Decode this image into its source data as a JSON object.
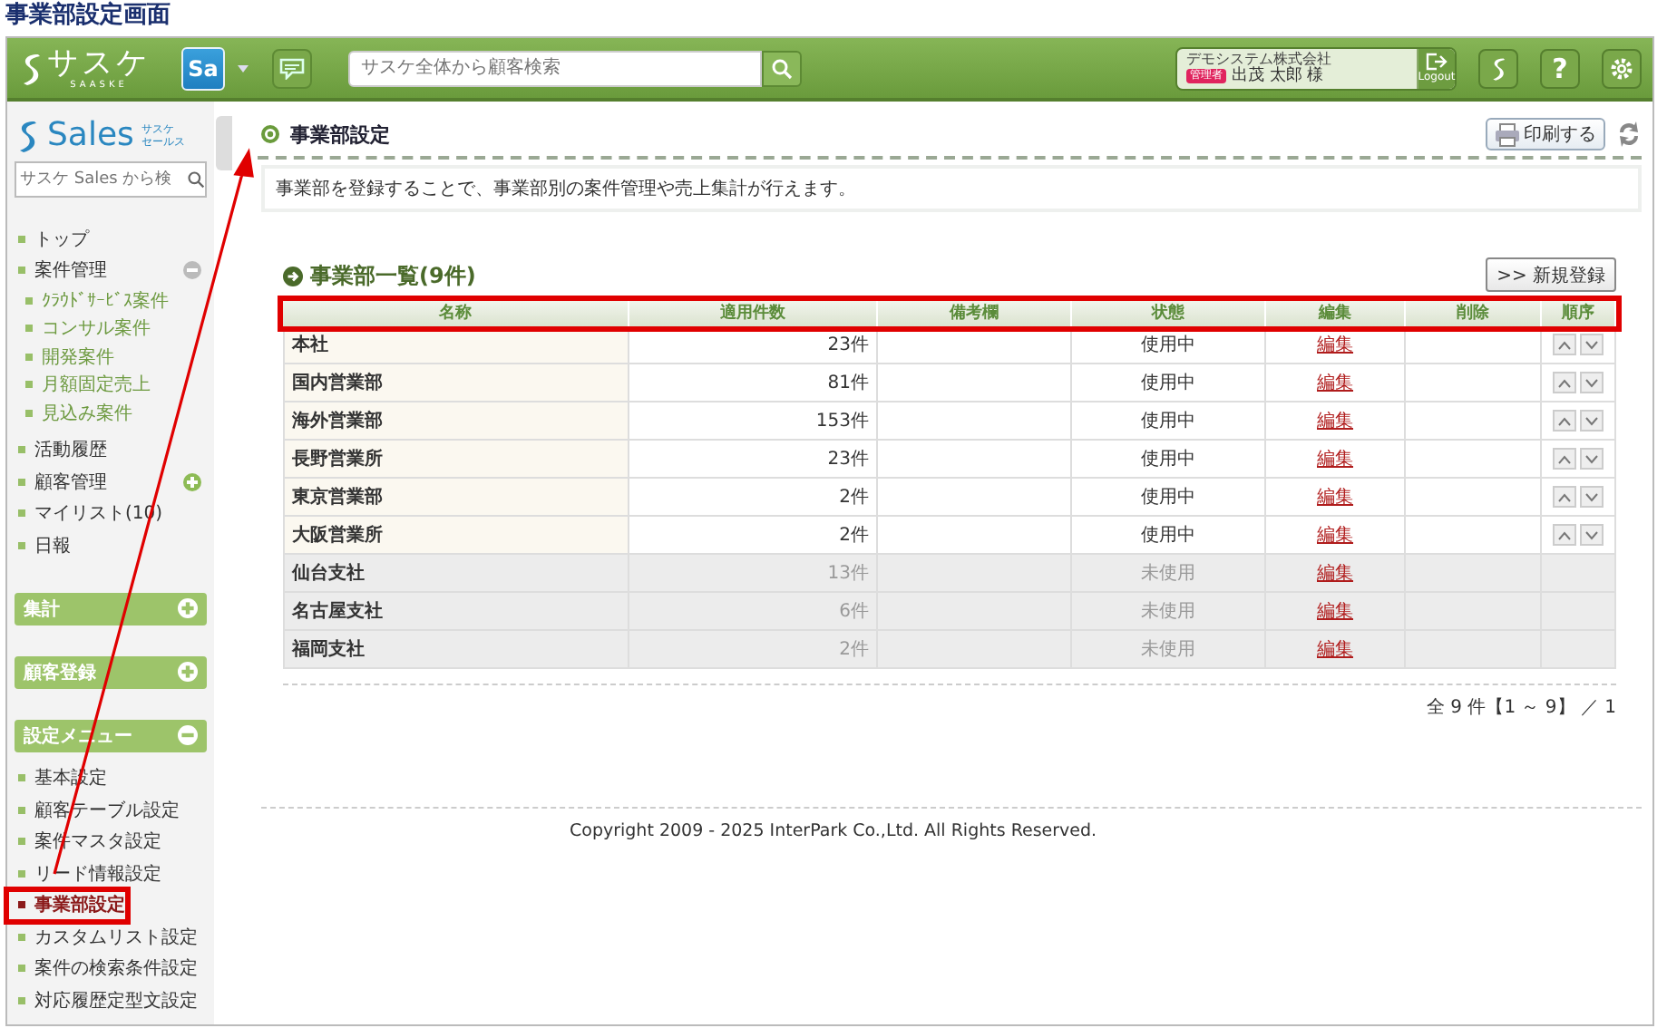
{
  "doc_title": "事業部設定画面",
  "header": {
    "logo": "サスケ",
    "logo_sub": "SAASKE",
    "app_badge": "Sa",
    "search": {
      "placeholder": "サスケ全体から顧客検索"
    },
    "company": "デモシステム株式会社",
    "role_badge": "管理者",
    "user": "出茂 太郎 様",
    "logout": "Logout",
    "help": "?"
  },
  "sidebar": {
    "brand": "Sales",
    "brand_sub": [
      "サスケ",
      "セールス"
    ],
    "search": {
      "placeholder": "サスケ Sales から検"
    },
    "items": [
      {
        "label": "トップ",
        "selected": false
      },
      {
        "label": "案件管理",
        "selected": false,
        "expanded": true,
        "children": [
          {
            "label": "ｸﾗｳﾄﾞｻｰﾋﾞｽ案件",
            "selected": false
          },
          {
            "label": "コンサル案件",
            "selected": false
          },
          {
            "label": "開発案件",
            "selected": false
          },
          {
            "label": "月額固定売上",
            "selected": false
          },
          {
            "label": "見込み案件",
            "selected": false
          }
        ]
      },
      {
        "label": "活動履歴",
        "selected": false
      },
      {
        "label": "顧客管理",
        "selected": false,
        "expanded": false
      },
      {
        "label": "マイリスト(10)",
        "selected": false
      },
      {
        "label": "日報",
        "selected": false
      }
    ],
    "sections": [
      {
        "label": "集計",
        "expanded": false
      },
      {
        "label": "顧客登録",
        "expanded": false
      },
      {
        "label": "設定メニュー",
        "expanded": true,
        "items": [
          {
            "label": "基本設定",
            "selected": false,
            "highlighted": false
          },
          {
            "label": "顧客テーブル設定",
            "selected": false,
            "highlighted": false
          },
          {
            "label": "案件マスタ設定",
            "selected": false,
            "highlighted": false
          },
          {
            "label": "リード情報設定",
            "selected": false,
            "highlighted": false
          },
          {
            "label": "事業部設定",
            "selected": true,
            "highlighted": true
          },
          {
            "label": "カスタムリスト設定",
            "selected": false,
            "highlighted": false
          },
          {
            "label": "案件の検索条件設定",
            "selected": false,
            "highlighted": false
          },
          {
            "label": "対応履歴定型文設定",
            "selected": false,
            "highlighted": false
          }
        ]
      }
    ]
  },
  "main": {
    "title": "事業部設定",
    "print_button": "印刷する",
    "description": "事業部を登録することで、事業部別の案件管理や売上集計が行えます。",
    "list_title": "事業部一覧(9件)",
    "new_button": ">> 新規登録",
    "table": {
      "header_highlighted": true,
      "columns": [
        "名称",
        "適用件数",
        "備考欄",
        "状態",
        "編集",
        "削除",
        "順序"
      ],
      "rows": [
        {
          "name": "本社",
          "count": "23件",
          "status": "使用中",
          "edit": "編集",
          "active": true
        },
        {
          "name": "国内営業部",
          "count": "81件",
          "status": "使用中",
          "edit": "編集",
          "active": true
        },
        {
          "name": "海外営業部",
          "count": "153件",
          "status": "使用中",
          "edit": "編集",
          "active": true
        },
        {
          "name": "長野営業所",
          "count": "23件",
          "status": "使用中",
          "edit": "編集",
          "active": true
        },
        {
          "name": "東京営業部",
          "count": "2件",
          "status": "使用中",
          "edit": "編集",
          "active": true
        },
        {
          "name": "大阪営業所",
          "count": "2件",
          "status": "使用中",
          "edit": "編集",
          "active": true
        },
        {
          "name": "仙台支社",
          "count": "13件",
          "status": "未使用",
          "edit": "編集",
          "active": false
        },
        {
          "name": "名古屋支社",
          "count": "6件",
          "status": "未使用",
          "edit": "編集",
          "active": false
        },
        {
          "name": "福岡支社",
          "count": "2件",
          "status": "未使用",
          "edit": "編集",
          "active": false
        }
      ]
    },
    "pagination": "全 9 件【1 ～ 9】 ／ 1",
    "copyright": "Copyright 2009 - 2025 InterPark Co.,Ltd. All Rights Reserved."
  }
}
